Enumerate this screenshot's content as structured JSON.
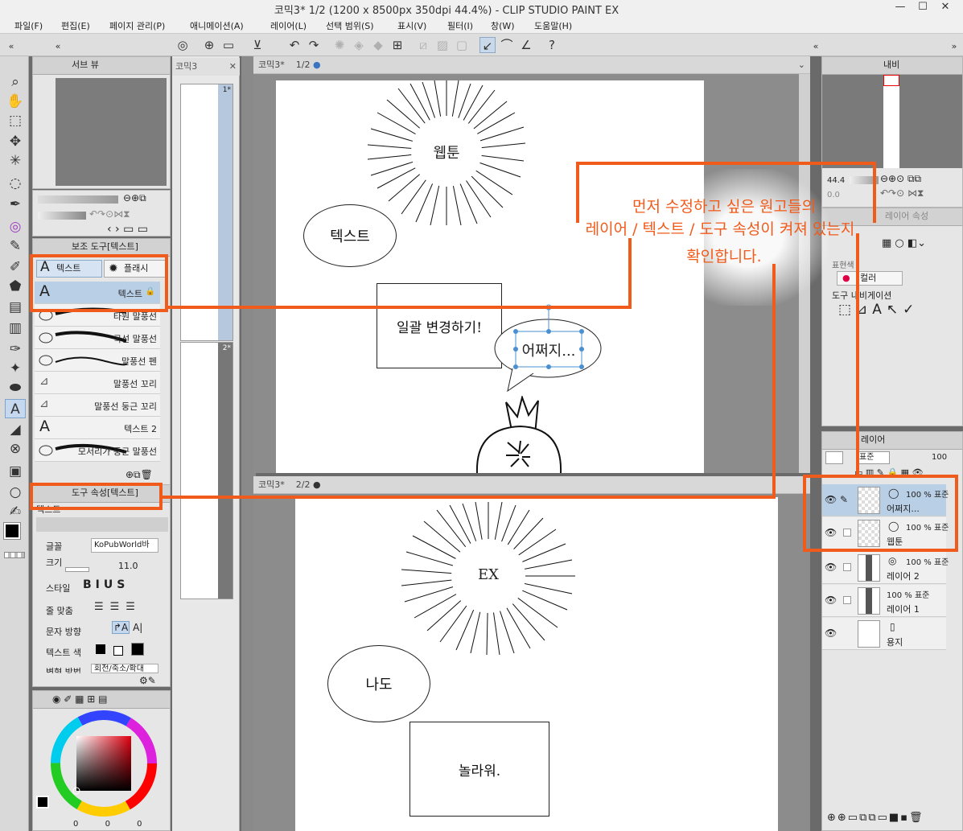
{
  "window": {
    "title": "코믹3* 1/2 (1200 x 8500px 350dpi 44.4%)  - CLIP STUDIO PAINT EX",
    "minimize": "—",
    "maximize": "☐",
    "close": "✕"
  },
  "menu": [
    "파일(F)",
    "편집(E)",
    "페이지 관리(P)",
    "애니메이션(A)",
    "레이어(L)",
    "선택 범위(S)",
    "표시(V)",
    "필터(I)",
    "창(W)",
    "도움말(H)"
  ],
  "left_panels": {
    "sub_view_tab": "서브 뷰",
    "subtool_tab": "보조 도구[텍스트]",
    "subtool_groups": [
      "텍스트",
      "플래시"
    ],
    "subtools": [
      "텍스트",
      "타원 말풍선",
      "곡선 말풍선",
      "말풍선 펜",
      "말풍선 꼬리",
      "말풍선 둥근 꼬리",
      "텍스트 2",
      "모서리가 둥근 말풍선"
    ],
    "tool_property_tab": "도구 속성[텍스트]",
    "tool_property_name": "텍스트",
    "props": {
      "font_label": "글꼴",
      "font_value": "KoPubWorld바",
      "size_label": "크기",
      "size_value": "11.0",
      "style_label": "스타일",
      "style_buttons": [
        "B",
        "I",
        "U",
        "S"
      ],
      "align_label": "줄 맞춤",
      "direction_label": "문자 방향",
      "direction_buttons": [
        "↱A",
        "A|"
      ],
      "color_label": "텍스트 색",
      "extra_label": "변형 방법",
      "extra_value": "회전/축소/확대"
    },
    "color_footer": [
      "0",
      "0",
      "0"
    ]
  },
  "page_manager": {
    "tab": "코믹3",
    "pages": [
      "1*",
      "2*"
    ]
  },
  "canvas": {
    "tab1": "코믹3*",
    "tab1_page": "1/2",
    "tab2": "코믹3*",
    "tab2_page": "2/2",
    "page1": {
      "burst_text": "웹툰",
      "ellipse_text": "텍스트",
      "box_text": "일괄 변경하기!",
      "selected_bubble": "어쩌지..."
    },
    "page2": {
      "burst_text": "EX",
      "ellipse_text": "나도",
      "box_text": "놀라워."
    }
  },
  "right_panels": {
    "navigator_tab": "내비",
    "zoom_value": "44.4",
    "rotate_value": "0.0",
    "layer_property_tab": "레이어 속성",
    "expression_label": "표현색",
    "color_mode": "컬러",
    "tool_nav_label": "도구 내비게이션",
    "layer_tab": "레이어",
    "blend_mode": "표준",
    "opacity_value": "100",
    "layers": [
      {
        "mode": "100 % 표준",
        "name": "어쩌지..."
      },
      {
        "mode": "100 % 표준",
        "name": "웹툰"
      },
      {
        "mode": "100 % 표준",
        "name": "레이어 2"
      },
      {
        "mode": "100 % 표준",
        "name": "레이어 1"
      },
      {
        "mode": "",
        "name": "용지"
      }
    ]
  },
  "annotation": {
    "line1": "먼저 수정하고 싶은 원고들의",
    "line2": "레이어 / 텍스트 / 도구 속성이 켜져 있는지",
    "line3": "확인합니다.",
    "color": "#f05a1a"
  }
}
